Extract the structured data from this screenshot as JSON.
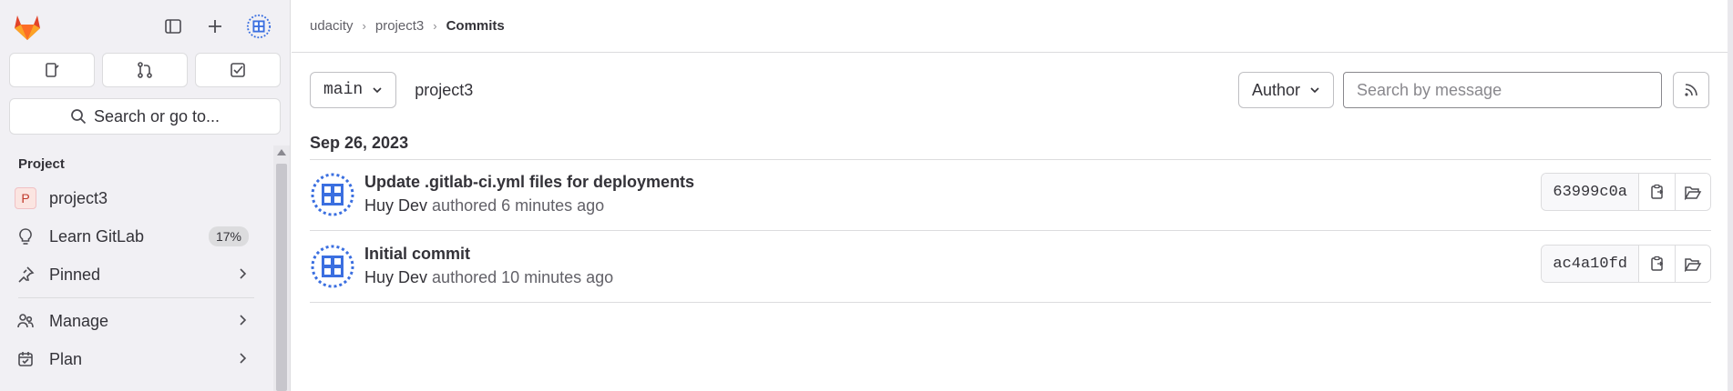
{
  "sidebar": {
    "search_label": "Search or go to...",
    "section_title": "Project",
    "project": {
      "letter": "P",
      "label": "project3"
    },
    "items": [
      {
        "label": "Learn GitLab",
        "badge": "17%"
      },
      {
        "label": "Pinned"
      },
      {
        "label": "Manage"
      },
      {
        "label": "Plan"
      }
    ]
  },
  "breadcrumb": {
    "items": [
      "udacity",
      "project3"
    ],
    "current": "Commits"
  },
  "filters": {
    "branch": "main",
    "project": "project3",
    "author_label": "Author",
    "search_placeholder": "Search by message"
  },
  "commit_group": {
    "date": "Sep 26, 2023",
    "commits": [
      {
        "title": "Update .gitlab-ci.yml files for deployments",
        "author": "Huy Dev",
        "time": "authored 6 minutes ago",
        "sha": "63999c0a"
      },
      {
        "title": "Initial commit",
        "author": "Huy Dev",
        "time": "authored 10 minutes ago",
        "sha": "ac4a10fd"
      }
    ]
  },
  "colors": {
    "accent": "#1f75cb",
    "avatar_blue": "#3b6fe0",
    "gitlab_orange": "#fc6d26"
  }
}
